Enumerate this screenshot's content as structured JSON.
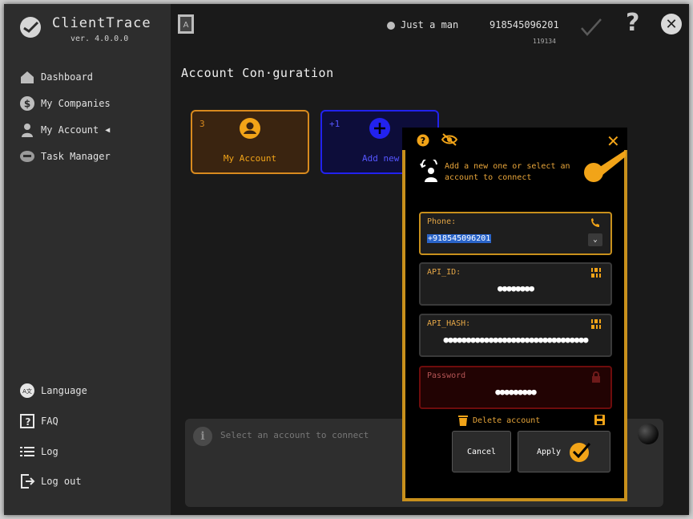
{
  "app": {
    "title": "ClientTrace",
    "version": "ver. 4.0.0.0"
  },
  "sidebar": {
    "items": [
      {
        "label": "Dashboard",
        "icon": "home-icon"
      },
      {
        "label": "My Companies",
        "icon": "dollar-icon"
      },
      {
        "label": "My Account",
        "icon": "person-icon",
        "active": true
      },
      {
        "label": "Task Manager",
        "icon": "task-icon"
      }
    ],
    "bottom": [
      {
        "label": "Language",
        "icon": "language-icon"
      },
      {
        "label": "FAQ",
        "icon": "faq-icon"
      },
      {
        "label": "Log",
        "icon": "log-icon"
      },
      {
        "label": "Log out",
        "icon": "logout-icon"
      }
    ]
  },
  "topbar": {
    "user": "Just a man",
    "phone": "918545096201",
    "user_id": "119134"
  },
  "page": {
    "title": "Account Con·guration"
  },
  "cards": {
    "my_account": {
      "count": "3",
      "label": "My Account"
    },
    "add_new": {
      "count": "+1",
      "label": "Add new"
    }
  },
  "info": {
    "text": "Select an account to connect"
  },
  "dialog": {
    "hint": "Add a new one or select an account to connect",
    "phone": {
      "label": "Phone:",
      "value": "+918545096201"
    },
    "api_id": {
      "label": "API_ID:",
      "value": "●●●●●●●●"
    },
    "api_hash": {
      "label": "API_HASH:",
      "value": "●●●●●●●●●●●●●●●●●●●●●●●●●●●●●●●●"
    },
    "password": {
      "label": "Password",
      "value": "●●●●●●●●●"
    },
    "delete_label": "Delete account",
    "cancel_label": "Cancel",
    "apply_label": "Apply"
  },
  "colors": {
    "accent": "#c8901c",
    "orange": "#f2a418",
    "add_blue": "#2222ee",
    "error_red": "#6e0c0c"
  }
}
